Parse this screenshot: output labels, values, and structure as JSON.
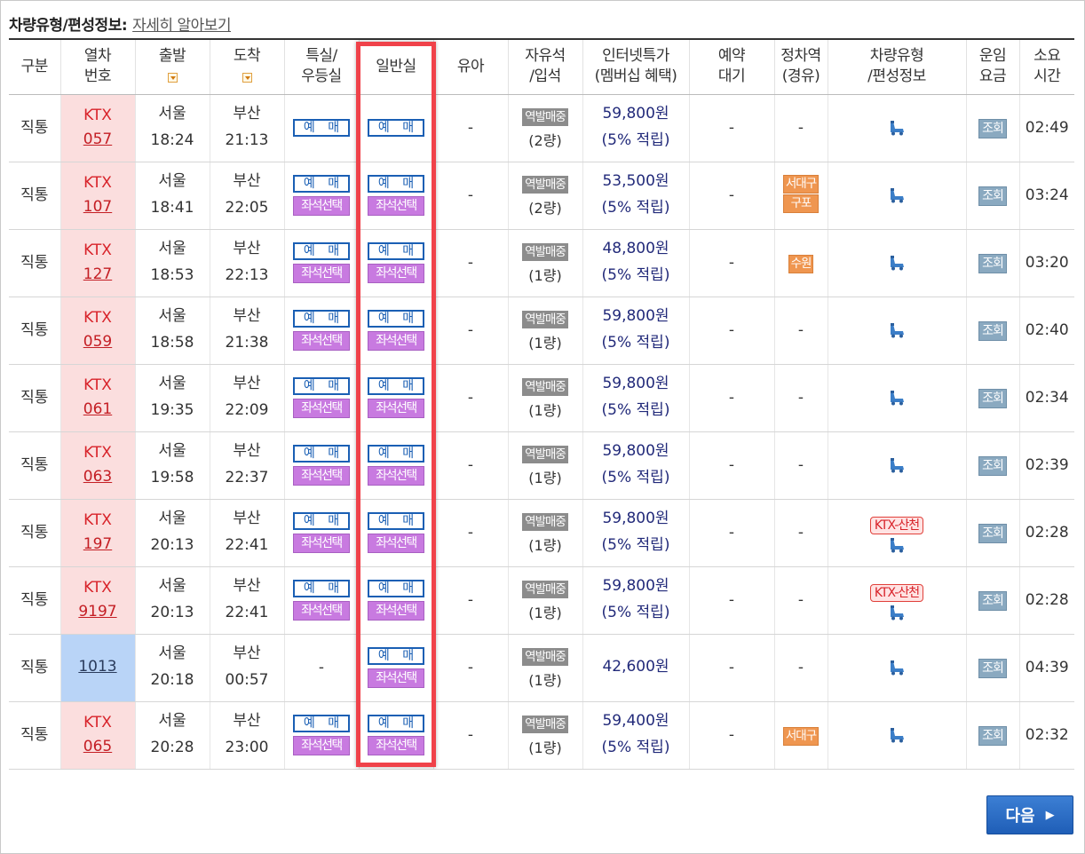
{
  "caption": {
    "label": "차량유형/편성정보:",
    "link": "자세히 알아보기"
  },
  "headers": {
    "type": "구분",
    "train_l1": "열차",
    "train_l2": "번호",
    "depart": "출발",
    "arrive": "도착",
    "special_l1": "특실/",
    "special_l2": "우등실",
    "general": "일반실",
    "infant": "유아",
    "free_l1": "자유석",
    "free_l2": "/입석",
    "price_l1": "인터넷특가",
    "price_l2": "(멤버십 혜택)",
    "wait_l1": "예약",
    "wait_l2": "대기",
    "stop_l1": "정차역",
    "stop_l2": "(경유)",
    "car_l1": "차량유형",
    "car_l2": "/편성정보",
    "fare_l1": "운임",
    "fare_l2": "요금",
    "time_l1": "소요",
    "time_l2": "시간"
  },
  "labels": {
    "reserve": "예 매",
    "seat_select": "좌석선택",
    "onsite": "역발매중",
    "fare_lookup": "조회",
    "benefit": "(5% 적립)",
    "dash": "-",
    "next": "다음"
  },
  "icons": {
    "train": "train-car-icon",
    "next": "chevron-right-icon",
    "sort": "sort-down-icon"
  },
  "colors": {
    "highlight": "#f0424a",
    "reserve": "#1a5fb4",
    "seat": "#c87ae0",
    "ktx": "#d8232a"
  },
  "rows": [
    {
      "type": "직통",
      "kind": "KTX",
      "num": "057",
      "from": "서울",
      "dep": "18:24",
      "to": "부산",
      "arr": "21:13",
      "free": "(2량)",
      "price": "59,800원",
      "duration": "02:49"
    },
    {
      "type": "직통",
      "kind": "KTX",
      "num": "107",
      "from": "서울",
      "dep": "18:41",
      "to": "부산",
      "arr": "22:05",
      "free": "(2량)",
      "price": "53,500원",
      "stations": [
        "서대구",
        "구포"
      ],
      "duration": "03:24"
    },
    {
      "type": "직통",
      "kind": "KTX",
      "num": "127",
      "from": "서울",
      "dep": "18:53",
      "to": "부산",
      "arr": "22:13",
      "free": "(1량)",
      "price": "48,800원",
      "stations": [
        "수원"
      ],
      "duration": "03:20"
    },
    {
      "type": "직통",
      "kind": "KTX",
      "num": "059",
      "from": "서울",
      "dep": "18:58",
      "to": "부산",
      "arr": "21:38",
      "free": "(1량)",
      "price": "59,800원",
      "duration": "02:40"
    },
    {
      "type": "직통",
      "kind": "KTX",
      "num": "061",
      "from": "서울",
      "dep": "19:35",
      "to": "부산",
      "arr": "22:09",
      "free": "(1량)",
      "price": "59,800원",
      "duration": "02:34"
    },
    {
      "type": "직통",
      "kind": "KTX",
      "num": "063",
      "from": "서울",
      "dep": "19:58",
      "to": "부산",
      "arr": "22:37",
      "free": "(1량)",
      "price": "59,800원",
      "duration": "02:39"
    },
    {
      "type": "직통",
      "kind": "KTX",
      "num": "197",
      "from": "서울",
      "dep": "20:13",
      "to": "부산",
      "arr": "22:41",
      "free": "(1량)",
      "price": "59,800원",
      "car_type": "KTX-산천",
      "duration": "02:28"
    },
    {
      "type": "직통",
      "kind": "KTX",
      "num": "9197",
      "from": "서울",
      "dep": "20:13",
      "to": "부산",
      "arr": "22:41",
      "free": "(1량)",
      "price": "59,800원",
      "car_type": "KTX-산천",
      "duration": "02:28"
    },
    {
      "type": "직통",
      "kind": "",
      "num": "1013",
      "from": "서울",
      "dep": "20:18",
      "to": "부산",
      "arr": "00:57",
      "free": "(1량)",
      "price": "42,600원",
      "duration": "04:39"
    },
    {
      "type": "직통",
      "kind": "KTX",
      "num": "065",
      "from": "서울",
      "dep": "20:28",
      "to": "부산",
      "arr": "23:00",
      "free": "(1량)",
      "price": "59,400원",
      "stations": [
        "서대구"
      ],
      "duration": "02:32"
    }
  ]
}
